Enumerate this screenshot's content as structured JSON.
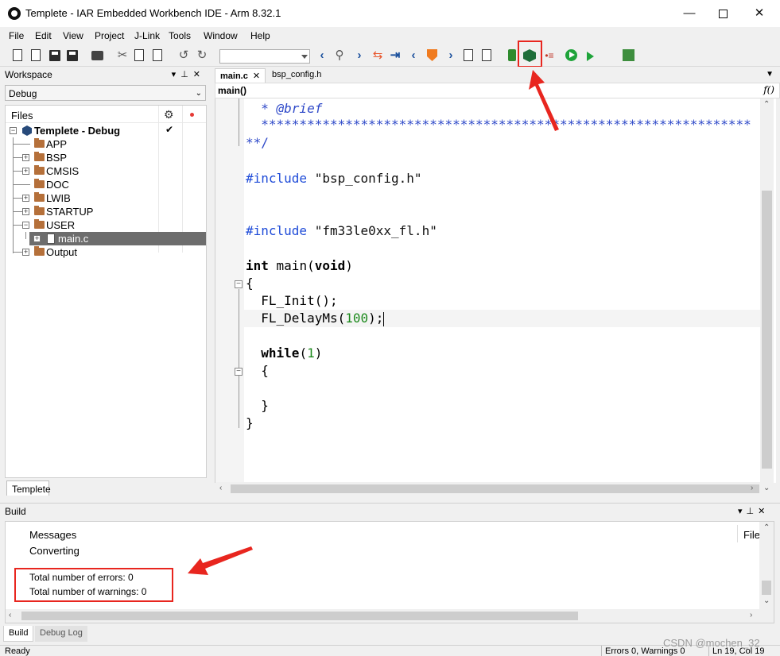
{
  "window": {
    "title": "Templete - IAR Embedded Workbench IDE - Arm 8.32.1",
    "minimize": "—",
    "close": "✕"
  },
  "menu": [
    "File",
    "Edit",
    "View",
    "Project",
    "J-Link",
    "Tools",
    "Window",
    "Help"
  ],
  "toolbar": {
    "combo_value": ""
  },
  "workspace": {
    "title": "Workspace",
    "config": "Debug",
    "files_header": "Files",
    "project": "Templete - Debug",
    "nodes": [
      "APP",
      "BSP",
      "CMSIS",
      "DOC",
      "LWIB",
      "STARTUP",
      "USER",
      "main.c",
      "Output"
    ],
    "tab": "Templete"
  },
  "editor": {
    "tabs": [
      "main.c",
      "bsp_config.h"
    ],
    "function": "main()",
    "code": {
      "brief_star": "* ",
      "brief_tag": "@brief",
      "stars": "****************************************************************",
      "close_comment": "**/",
      "inc1_kw": "#include",
      "inc1_file": "\"bsp_config.h\"",
      "inc2_kw": "#include",
      "inc2_file": "\"fm33le0xx_fl.h\"",
      "main_type": "int",
      "main_name": " main(",
      "main_void": "void",
      "main_close": ")",
      "brace_open": "{",
      "init": "  FL_Init();",
      "delay_fn": "  FL_DelayMs(",
      "delay_num": "100",
      "delay_end": ");",
      "while_kw": "  while",
      "while_open": "(",
      "while_num": "1",
      "while_close": ")",
      "inner_open": "  {",
      "inner_close": "  }",
      "brace_close": "}"
    }
  },
  "build": {
    "title": "Build",
    "col_messages": "Messages",
    "col_file": "File",
    "lines": [
      "Converting",
      "Total number of errors: 0",
      "Total number of warnings: 0"
    ],
    "tabs": [
      "Build",
      "Debug Log"
    ]
  },
  "status": {
    "ready": "Ready",
    "errors": "Errors 0, Warnings 0",
    "position": "Ln 19, Col 19"
  },
  "watermark": "CSDN @mochen_32",
  "colors": {
    "highlight": "#e8261f",
    "keyword": "#1e4bd8",
    "number": "#1d8a1d",
    "selection": "#6d6d6d"
  },
  "icons": [
    "new-file-icon",
    "open-file-icon",
    "save-icon",
    "save-all-icon",
    "print-icon",
    "cut-icon",
    "copy-icon",
    "paste-icon",
    "undo-icon",
    "redo-icon",
    "find-icon",
    "download-icon",
    "download-and-debug-icon",
    "run-icon",
    "debug-without-download-icon",
    "make-icon"
  ]
}
